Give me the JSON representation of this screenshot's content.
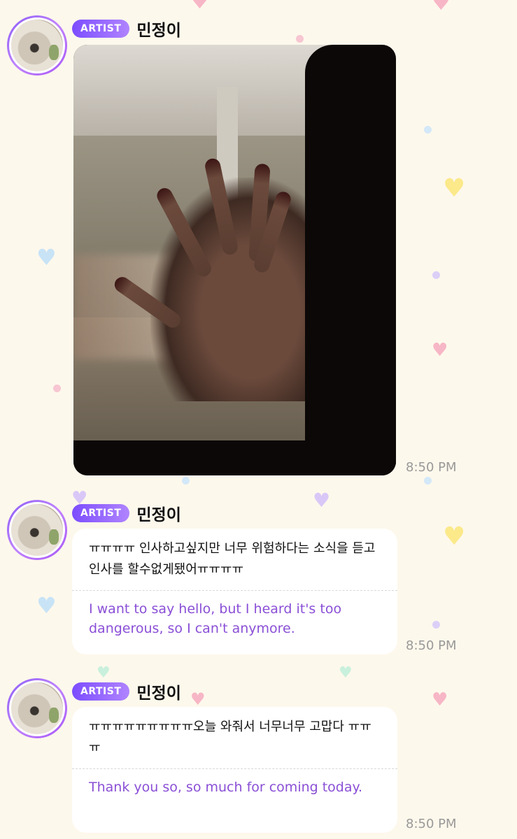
{
  "messages": [
    {
      "badge": "ARTIST",
      "sender": "민정이",
      "type": "image",
      "time": "8:50 PM"
    },
    {
      "badge": "ARTIST",
      "sender": "민정이",
      "type": "text",
      "text": "ㅠㅠㅠㅠ 인사하고싶지만 너무 위험하다는 소식을 듣고 인사를 할수없게됐어ㅠㅠㅠㅠ",
      "translation": "I want to say hello, but I heard it's too dangerous, so I can't anymore.",
      "time": "8:50 PM"
    },
    {
      "badge": "ARTIST",
      "sender": "민정이",
      "type": "text",
      "text": "ㅠㅠㅠㅠㅠㅠㅠㅠㅠ오늘 와줘서 너무너무 고맙다 ㅠㅠㅠ",
      "translation": "Thank you so, so much for coming today.",
      "time": "8:50 PM"
    }
  ],
  "colors": {
    "background": "#fdf8ec",
    "badge": "#7c4dff",
    "translation_text": "#8a4fd6",
    "timestamp": "#999999"
  }
}
